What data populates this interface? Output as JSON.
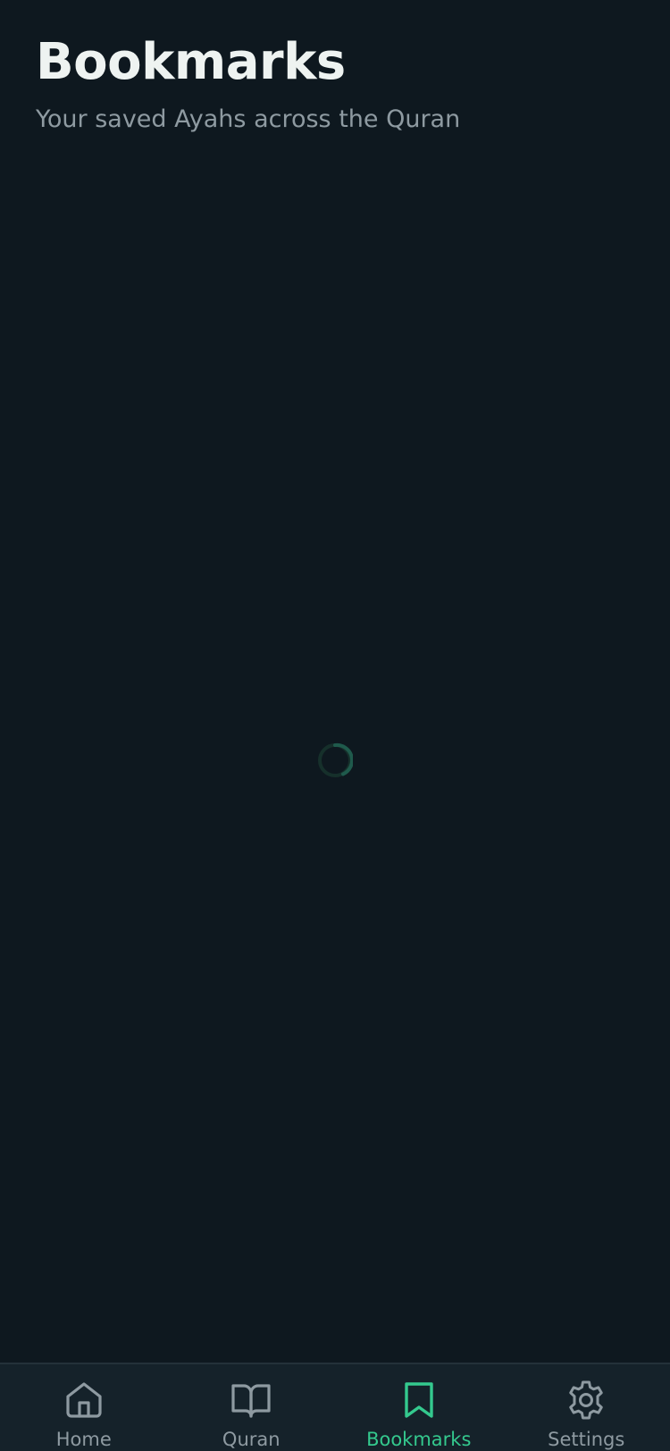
{
  "header": {
    "title": "Bookmarks",
    "subtitle": "Your saved Ayahs across the Quran"
  },
  "content": {
    "state": "loading",
    "spinner_color": "#1f5a4c"
  },
  "tabbar": {
    "active_color": "#34c98e",
    "inactive_color": "#8e9aa1",
    "tabs": [
      {
        "label": "Home",
        "icon": "home-icon",
        "active": false
      },
      {
        "label": "Quran",
        "icon": "book-open-icon",
        "active": false
      },
      {
        "label": "Bookmarks",
        "icon": "bookmark-icon",
        "active": true
      },
      {
        "label": "Settings",
        "icon": "gear-icon",
        "active": false
      }
    ]
  }
}
